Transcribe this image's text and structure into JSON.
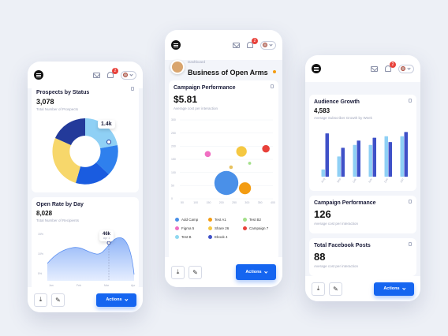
{
  "phone1": {
    "prospects": {
      "title": "Prospects by Status",
      "value": "3,078",
      "subtitle": "Total Number of Prospects",
      "tooltip": "1.4k"
    },
    "open_rate": {
      "title": "Open Rate by Day",
      "value": "8,028",
      "subtitle": "Total Number of Recipients",
      "tooltip": "46k",
      "tooltip_sub": "Apr 1",
      "yticks": [
        "15%",
        "10%",
        "5%"
      ],
      "xticks": [
        "Jan",
        "Feb",
        "Mar",
        "Apr"
      ]
    },
    "actions_label": "Actions"
  },
  "phone2": {
    "breadcrumb": "Dashboard",
    "title": "Business of Open Arms",
    "campaign": {
      "title": "Campaign Performance",
      "value": "$5.81",
      "subtitle": "Average cost per interaction"
    },
    "chart_data": {
      "type": "scatter",
      "title": "",
      "xlabel": "",
      "ylabel": "",
      "xticks": [
        "50",
        "100",
        "150",
        "200",
        "250",
        "300",
        "350",
        "400"
      ],
      "yticks": [
        "300",
        "250",
        "200",
        "150",
        "100",
        "50",
        "0"
      ],
      "series": [
        {
          "name": "Add Camp",
          "x": 200,
          "y": 60,
          "r": 8,
          "color": "#4a90e8"
        },
        {
          "name": "Test A1",
          "x": 280,
          "y": 40,
          "r": 4,
          "color": "#f39c12"
        },
        {
          "name": "Test B2",
          "x": 265,
          "y": 180,
          "r": 3.5,
          "color": "#f5c842"
        },
        {
          "name": "Figma 5",
          "x": 120,
          "y": 170,
          "r": 2,
          "color": "#f06fc2"
        },
        {
          "name": "Share 26",
          "x": 220,
          "y": 120,
          "r": 1.2,
          "color": "#e8c260"
        },
        {
          "name": "Campaign 7",
          "x": 370,
          "y": 190,
          "r": 2.5,
          "color": "#e8413a"
        },
        {
          "name": "Test B",
          "x": 300,
          "y": 135,
          "r": 1,
          "color": "#a3e08a"
        }
      ]
    },
    "legend": [
      {
        "label": "Add Camp",
        "color": "#4a90e8"
      },
      {
        "label": "Test A1",
        "color": "#f39c12"
      },
      {
        "label": "Test B2",
        "color": "#a3e08a"
      },
      {
        "label": "Figma 5",
        "color": "#f06fc2"
      },
      {
        "label": "Share 26",
        "color": "#f5c842"
      },
      {
        "label": "Campaign 7",
        "color": "#e8413a"
      },
      {
        "label": "Test B",
        "color": "#8fd8f0"
      },
      {
        "label": "Ebook 4",
        "color": "#3f51c8"
      }
    ],
    "actions_label": "Actions"
  },
  "phone3": {
    "audience": {
      "title": "Audience Growth",
      "value": "4,583",
      "subtitle": "Average Subscriber Growth by Week",
      "chart_data": {
        "type": "bar",
        "categories": [
          "Aug",
          "Sep",
          "Oct",
          "Nov",
          "Dec",
          "Jan"
        ],
        "series": [
          {
            "values": [
              5,
              14,
              22,
              22,
              28,
              28
            ],
            "color": "#8fd0f5"
          },
          {
            "values": [
              30,
              20,
              25,
              27,
              24,
              31
            ],
            "color": "#3f51c8"
          }
        ],
        "ylim": [
          0,
          35
        ]
      }
    },
    "campaign": {
      "title": "Campaign Performance",
      "value": "126",
      "subtitle": "Average cost per interaction"
    },
    "facebook": {
      "title": "Total Facebook Posts",
      "value": "88",
      "subtitle": "Average cost per interaction"
    },
    "actions_label": "Actions"
  }
}
